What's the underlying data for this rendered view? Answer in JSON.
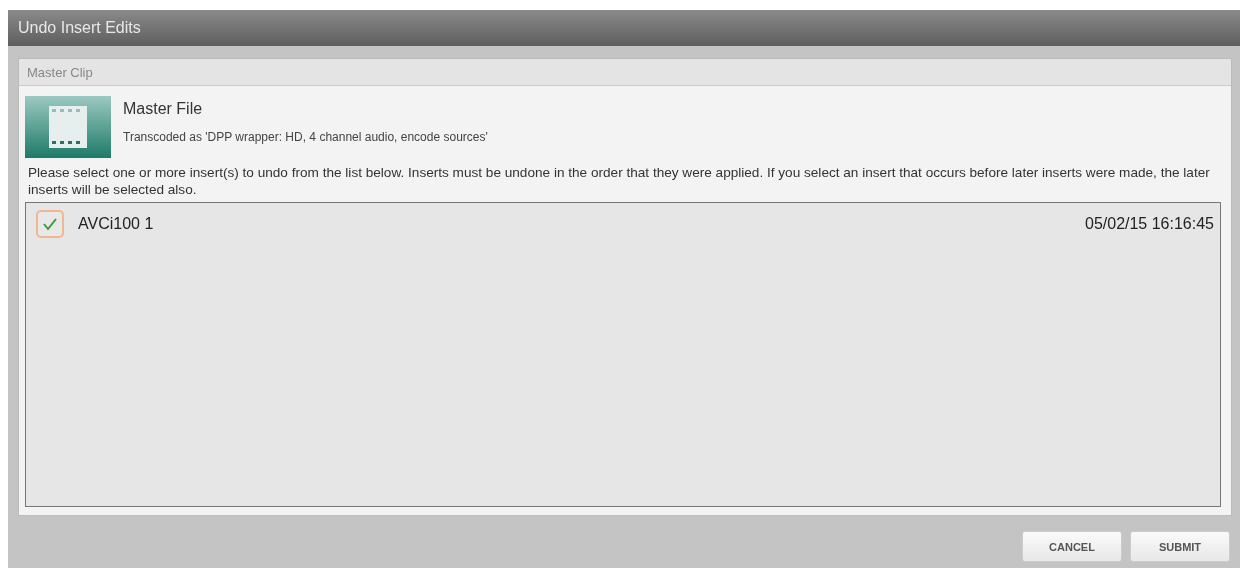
{
  "window": {
    "title": "Undo Insert Edits"
  },
  "panel": {
    "title": "Master Clip"
  },
  "file": {
    "name": "Master File",
    "description": "Transcoded as 'DPP wrapper: HD, 4 channel audio, encode sources'"
  },
  "instructions": "Please select one or more insert(s) to undo from the list below. Inserts must be undone in the order that they were applied. If you select an insert that occurs before later inserts were made, the later inserts will be selected also.",
  "inserts": [
    {
      "name": "AVCi100 1",
      "date": "05/02/15 16:16:45",
      "checked": true
    }
  ],
  "buttons": [
    "CANCEL",
    "SUBMIT"
  ]
}
